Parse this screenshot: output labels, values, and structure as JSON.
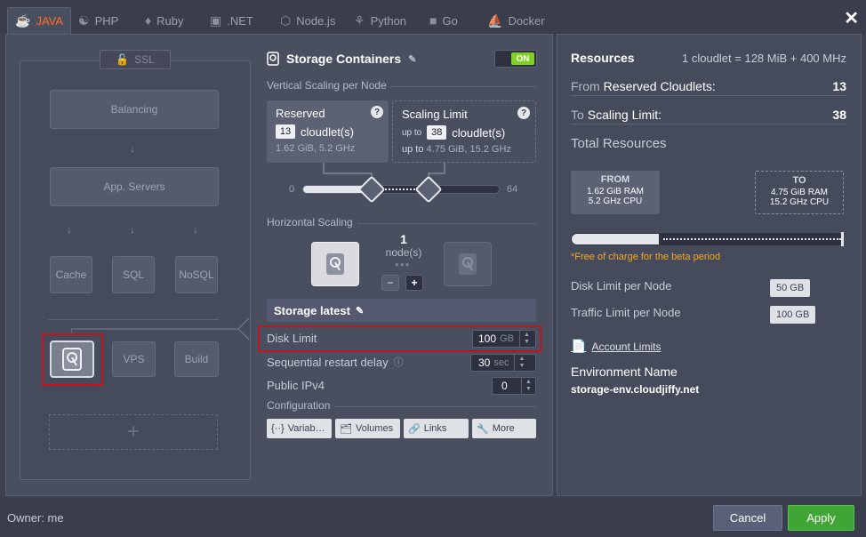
{
  "tabs": [
    {
      "label": "JAVA",
      "icon": "java-icon"
    },
    {
      "label": "PHP",
      "icon": "php-icon"
    },
    {
      "label": "Ruby",
      "icon": "ruby-icon"
    },
    {
      "label": ".NET",
      "icon": "dotnet-icon"
    },
    {
      "label": "Node.js",
      "icon": "nodejs-icon"
    },
    {
      "label": "Python",
      "icon": "python-icon"
    },
    {
      "label": "Go",
      "icon": "go-icon"
    },
    {
      "label": "Docker",
      "icon": "docker-icon"
    }
  ],
  "active_tab": "JAVA",
  "topology": {
    "ssl": "SSL",
    "balancing": "Balancing",
    "app_servers": "App. Servers",
    "cache": "Cache",
    "sql": "SQL",
    "nosql": "NoSQL",
    "vps": "VPS",
    "build": "Build",
    "add": "+"
  },
  "config": {
    "title": "Storage Containers",
    "toggle": "ON",
    "vertical_scaling": "Vertical Scaling per Node",
    "reserved": {
      "title": "Reserved",
      "value": "13",
      "unit": "cloudlet(s)",
      "sub": "1.62 GiB, 5.2 GHz"
    },
    "scaling_limit": {
      "title": "Scaling Limit",
      "prefix": "up to",
      "value": "38",
      "unit": "cloudlet(s)",
      "sub_prefix": "up to",
      "sub": "4.75 GiB, 15.2 GHz"
    },
    "slider_min": "0",
    "slider_max": "64",
    "horizontal_scaling": "Horizontal Scaling",
    "nodes_count": "1",
    "nodes_label": "node(s)",
    "minus": "−",
    "plus": "+",
    "stack": "Storage latest",
    "disk_limit": {
      "label": "Disk Limit",
      "value": "100",
      "unit": "GB"
    },
    "restart_delay": {
      "label": "Sequential restart delay",
      "value": "30",
      "unit": "sec"
    },
    "ipv4": {
      "label": "Public IPv4",
      "value": "0"
    },
    "configuration": "Configuration",
    "buttons": [
      "Variab…",
      "Volumes",
      "Links",
      "More"
    ]
  },
  "resources": {
    "title": "Resources",
    "note": "1 cloudlet = 128 MiB + 400 MHz",
    "reserved_pre": "From",
    "reserved_label": "Reserved Cloudlets:",
    "reserved_value": "13",
    "limit_pre": "To",
    "limit_label": "Scaling Limit:",
    "limit_value": "38",
    "total": "Total Resources",
    "from": {
      "head": "FROM",
      "ram": "1.62 GiB RAM",
      "cpu": "5.2 GHz CPU"
    },
    "to": {
      "head": "TO",
      "ram": "4.75 GiB RAM",
      "cpu": "15.2 GHz CPU"
    },
    "beta": "*Free of charge for the beta period",
    "disk_limit_label": "Disk Limit per Node",
    "disk_limit_value": "50 GB",
    "traffic_limit_label": "Traffic Limit per Node",
    "traffic_limit_value": "100 GB",
    "account_limits": "Account Limits",
    "env_label": "Environment Name",
    "env_value": "storage-env.cloudjiffy.net"
  },
  "footer": {
    "owner": "Owner: me",
    "cancel": "Cancel",
    "apply": "Apply"
  },
  "colors": {
    "accent": "#ff6a2a",
    "toggle_on": "#7ed321",
    "apply": "#3fa535",
    "highlight": "#c4131f",
    "beta": "#f5a623"
  }
}
